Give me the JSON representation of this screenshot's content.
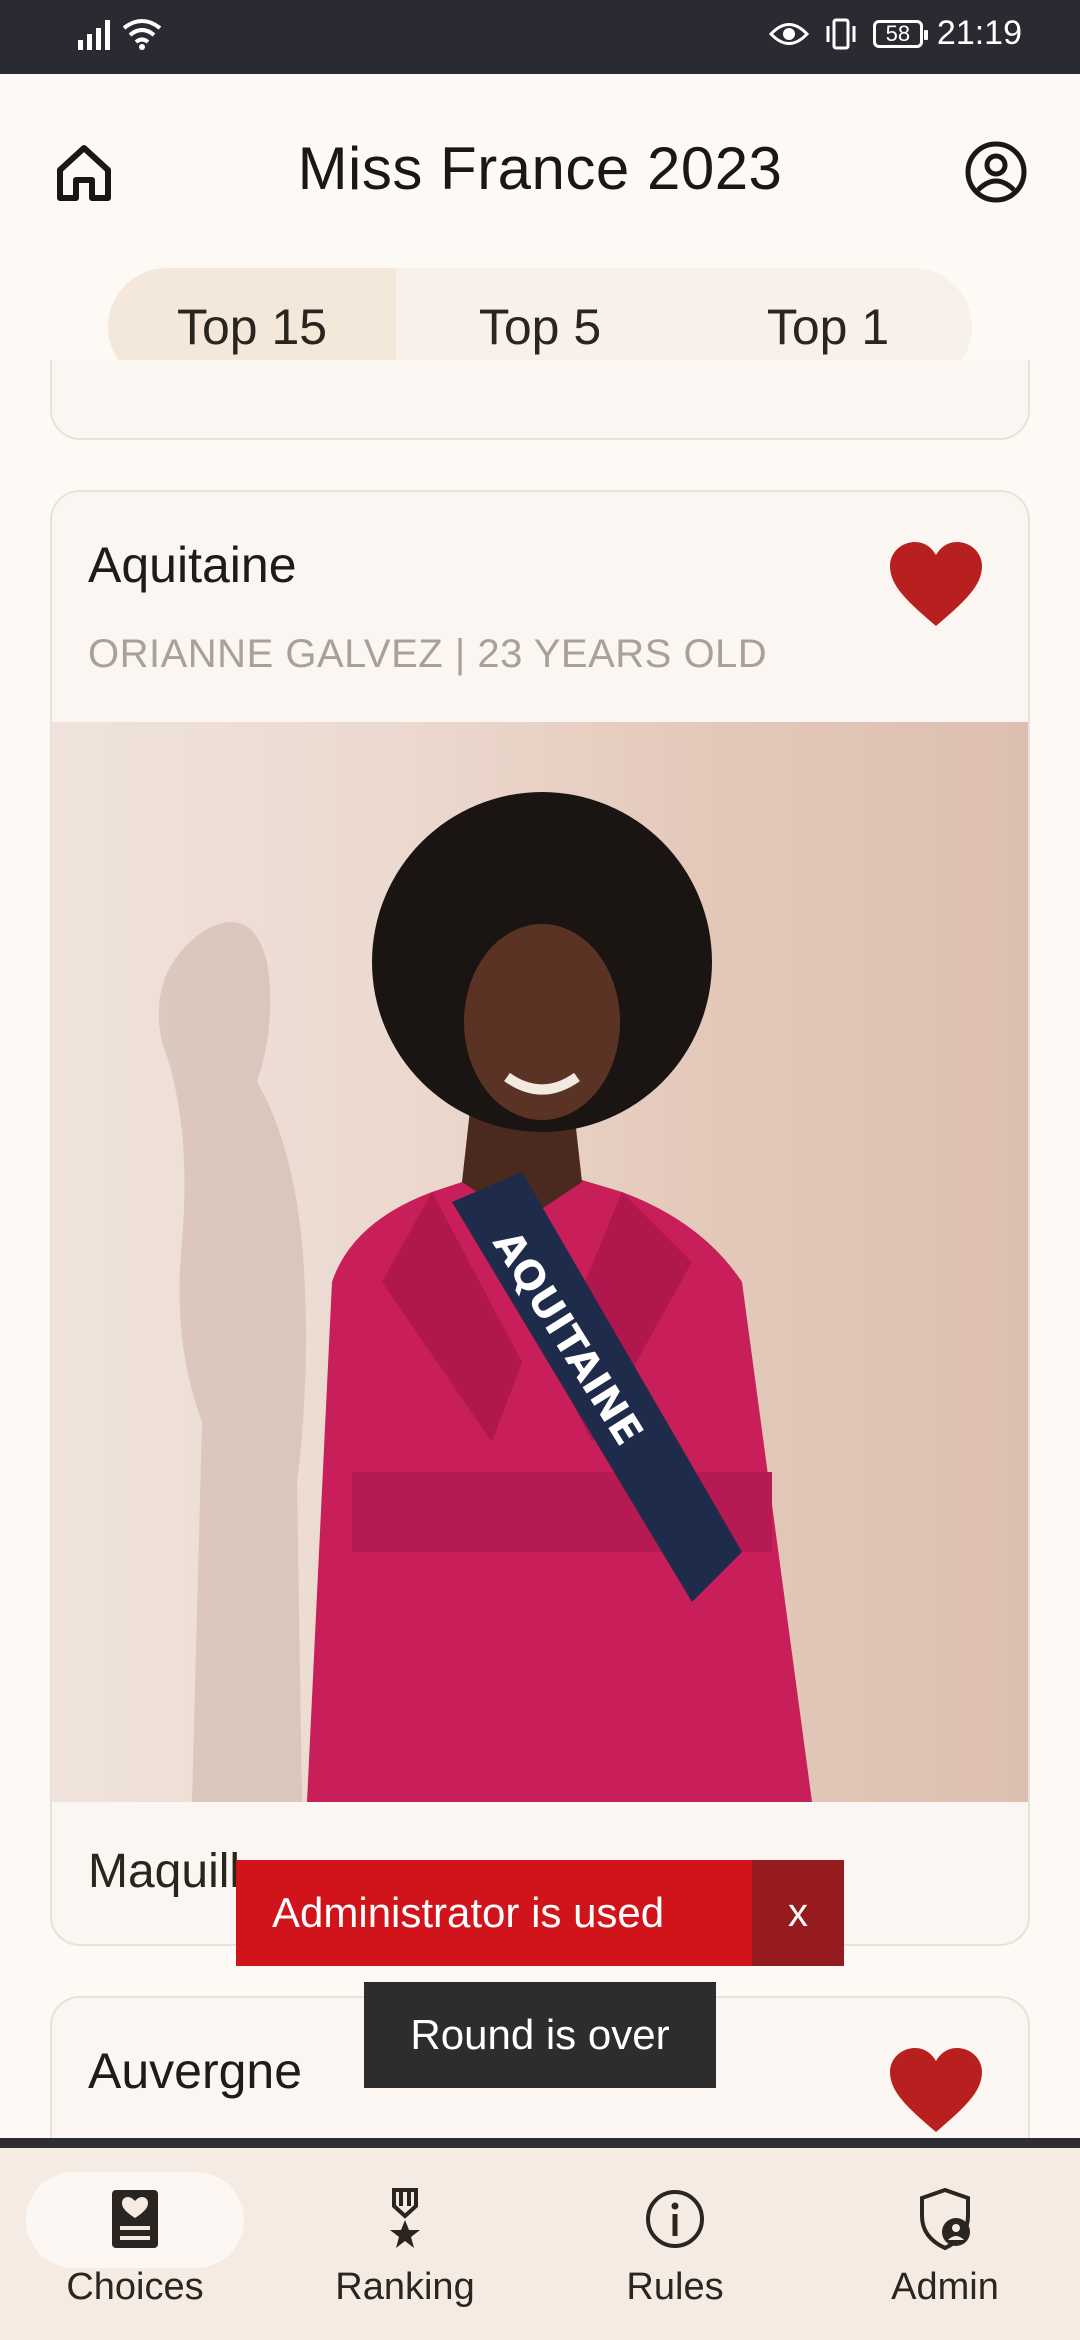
{
  "status_bar": {
    "time": "21:19",
    "battery": "58"
  },
  "header": {
    "title": "Miss France 2023"
  },
  "tabs": [
    {
      "label": "Top 15",
      "active": true
    },
    {
      "label": "Top 5",
      "active": false
    },
    {
      "label": "Top 1",
      "active": false
    }
  ],
  "cards": [
    {
      "region": "Aquitaine",
      "subtitle": "ORIANNE GALVEZ | 23 YEARS OLD",
      "favorite": true,
      "sash_text": "AQUITAINE",
      "description": "Maquill"
    },
    {
      "region": "Auvergne",
      "favorite": true
    }
  ],
  "toasts": {
    "admin_message": "Administrator is used",
    "admin_close": "x",
    "round_message": "Round is over"
  },
  "bottom_nav": [
    {
      "label": "Choices",
      "icon": "choices-icon",
      "active": true
    },
    {
      "label": "Ranking",
      "icon": "medal-icon",
      "active": false
    },
    {
      "label": "Rules",
      "icon": "info-icon",
      "active": false
    },
    {
      "label": "Admin",
      "icon": "admin-shield-icon",
      "active": false
    }
  ],
  "colors": {
    "accent_heart": "#b81f1f",
    "toast_red": "#d1141b",
    "toast_dark": "#2d2d2d"
  }
}
